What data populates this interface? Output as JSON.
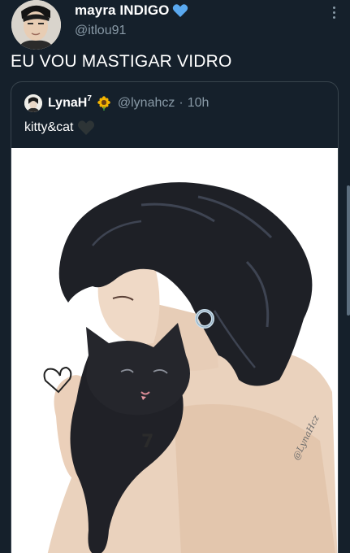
{
  "tweet": {
    "author": {
      "display_name": "mayra INDIGO",
      "handle": "@itlou91",
      "badge_icon": "blue-heart-icon",
      "badge_color": "#5aa9f0"
    },
    "text": "EU VOU MASTIGAR VIDRO",
    "more_icon": "more-vertical-icon"
  },
  "quoted_tweet": {
    "display_name": "LynaH",
    "name_superscript": "7",
    "name_icon": "sunflower-icon",
    "handle": "@lynahcz",
    "separator": "·",
    "time": "10h",
    "text": "kitty&cat",
    "text_icon": "black-heart-icon",
    "media": {
      "description_icon": "illustration-image",
      "watermark": "@LynaHcz",
      "drawn_marks": [
        "7"
      ]
    }
  },
  "theme": {
    "background": "#15202b",
    "text_primary": "#ffffff",
    "text_secondary": "#8899a6",
    "border": "#38444d"
  }
}
